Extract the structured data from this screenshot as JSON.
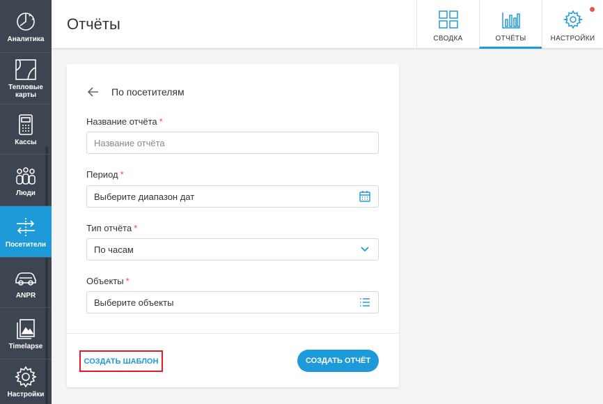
{
  "sidebar": {
    "items": [
      {
        "label": "Аналитика",
        "icon": "analytics-icon"
      },
      {
        "label": "Тепловые карты",
        "icon": "heatmap-icon"
      },
      {
        "label": "Кассы",
        "icon": "cash-register-icon"
      },
      {
        "label": "Люди",
        "icon": "people-icon"
      },
      {
        "label": "Посетители",
        "icon": "visitors-icon",
        "active": true
      },
      {
        "label": "ANPR",
        "icon": "car-icon"
      },
      {
        "label": "Timelapse",
        "icon": "timelapse-icon"
      },
      {
        "label": "Настройки",
        "icon": "gear-icon"
      }
    ]
  },
  "header": {
    "title": "Отчёты",
    "tabs": [
      {
        "label": "СВОДКА",
        "icon": "dashboard-icon"
      },
      {
        "label": "ОТЧЁТЫ",
        "icon": "bar-chart-icon",
        "active": true
      },
      {
        "label": "НАСТРОЙКИ",
        "icon": "gear-icon",
        "notification": true
      }
    ]
  },
  "form": {
    "back_title": "По посетителям",
    "required_mark": "*",
    "report_name": {
      "label": "Название отчёта",
      "placeholder": "Название отчёта",
      "value": ""
    },
    "period": {
      "label": "Период",
      "value": "Выберите диапазон дат"
    },
    "report_type": {
      "label": "Тип отчёта",
      "value": "По часам"
    },
    "objects": {
      "label": "Объекты",
      "value": "Выберите объекты"
    },
    "template_button": "СОЗДАТЬ ШАБЛОН",
    "create_button": "СОЗДАТЬ ОТЧЁТ"
  },
  "colors": {
    "accent": "#1e9ad8",
    "sidebar_bg": "#3d4650",
    "required": "#e84c4c",
    "highlight_box": "#e01b24"
  }
}
